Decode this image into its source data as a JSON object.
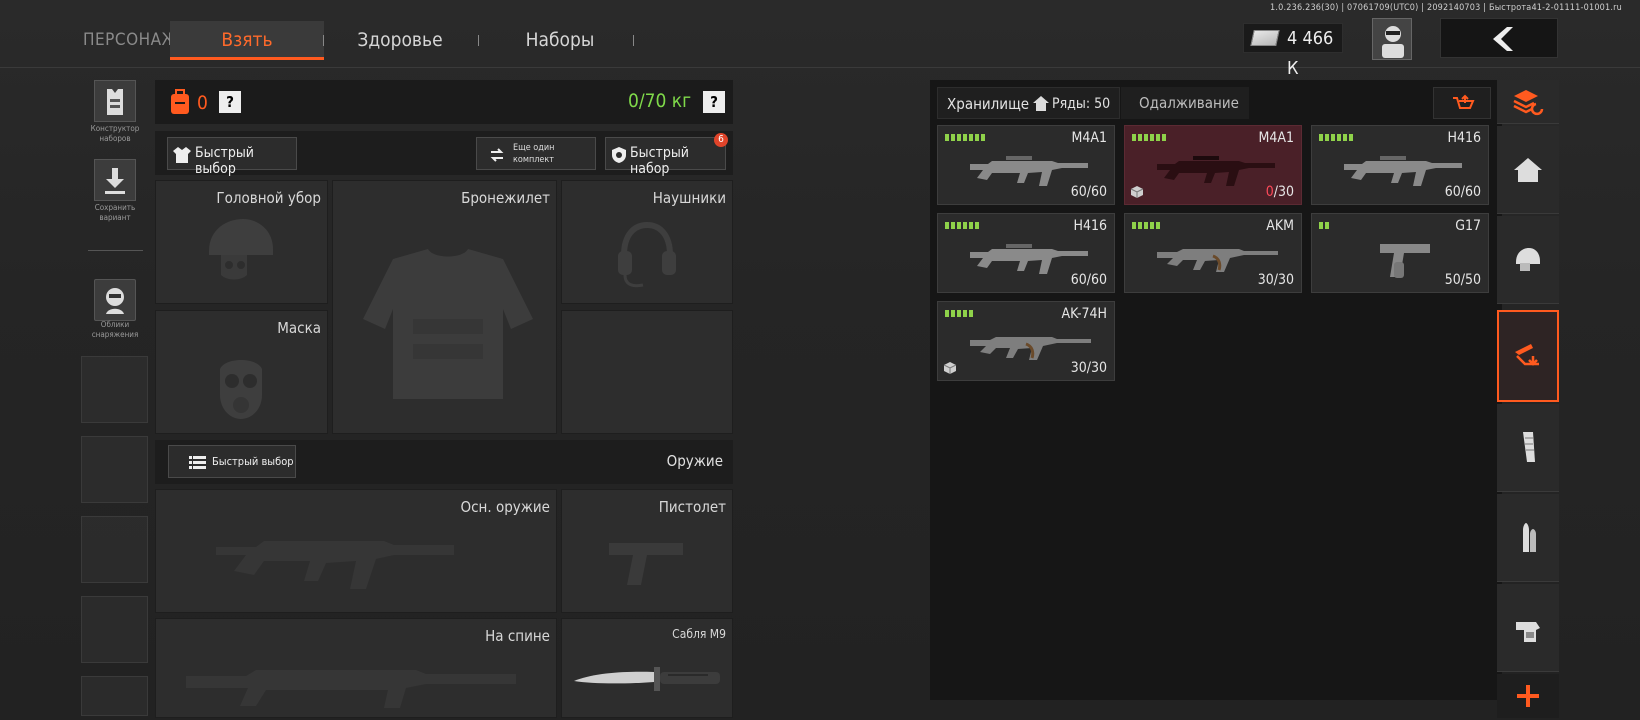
{
  "version_info": "1.0.236.236(30) | 07061709(UTC0) | 2092140703 | Быстрота41-2-01111-01001.ru",
  "nav": {
    "character_label": "ПЕРСОНАЖ",
    "tabs": [
      "Взять",
      "Здоровье",
      "Наборы"
    ],
    "active_tab": "Взять"
  },
  "currency": {
    "amount": "4 466 К"
  },
  "left_sidebar": {
    "kit_builder_label": "Конструктор наборов",
    "save_variant_label": "Сохранить вариант",
    "equipment_skins_label": "Облики снаряжения"
  },
  "equipment": {
    "backpack_count": "0",
    "help": "?",
    "weight": "0/70 кг",
    "quick_select": "Быстрый выбор",
    "another_kit": "Еще один комплект",
    "quick_kit": "Быстрый набор",
    "quick_kit_badge": "6",
    "slots": {
      "headgear": "Головной убор",
      "vest": "Бронежилет",
      "headphones": "Наушники",
      "mask": "Маска"
    }
  },
  "weapons": {
    "quick_select": "Быстрый выбор",
    "section_title": "Оружие",
    "primary": "Осн. оружие",
    "pistol": "Пистолет",
    "back": "На спине",
    "melee": "Сабля М9"
  },
  "storage": {
    "title": "Хранилище",
    "rows_label": "Ряды: 50",
    "lending_tab": "Одалживание",
    "items": [
      {
        "name": "M4A1",
        "ammo": "60/60",
        "level": 7,
        "highlight": false,
        "crate": false
      },
      {
        "name": "M4A1",
        "ammo_current": "0",
        "ammo_max": "/30",
        "level": 6,
        "highlight": true,
        "crate": true
      },
      {
        "name": "H416",
        "ammo": "60/60",
        "level": 6,
        "highlight": false,
        "crate": false
      },
      {
        "name": "H416",
        "ammo": "60/60",
        "level": 6,
        "highlight": false,
        "crate": false
      },
      {
        "name": "AKM",
        "ammo": "30/30",
        "level": 5,
        "highlight": false,
        "crate": false
      },
      {
        "name": "G17",
        "ammo": "50/50",
        "level": 2,
        "highlight": false,
        "crate": false
      },
      {
        "name": "AK-74H",
        "ammo": "30/30",
        "level": 5,
        "highlight": false,
        "crate": true
      }
    ]
  },
  "colors": {
    "accent": "#ff5a1f",
    "level_green": "#8fd24a",
    "weight_green": "#7fd94a",
    "highlight_card": "#4a2028"
  },
  "icons": [
    "money-icon",
    "avatar-icon",
    "back-arrow-icon",
    "vest-icon",
    "download-icon",
    "skin-icon",
    "backpack-icon",
    "shirt-icon",
    "swap-icon",
    "shield-icon",
    "ammo-icon",
    "home-icon",
    "layers-refresh-icon",
    "helmet-icon",
    "weapon-download-icon",
    "magazine-icon",
    "bullet-icon",
    "holster-icon",
    "plus-icon",
    "crate-icon",
    "restock-icon"
  ]
}
